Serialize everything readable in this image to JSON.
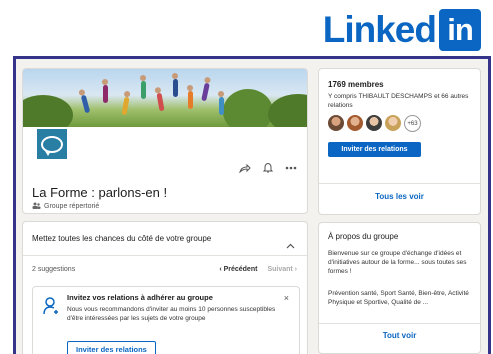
{
  "logo": {
    "text": "Linked",
    "box_text": "in"
  },
  "group": {
    "title": "La Forme : parlons-en !",
    "subtitle": "Groupe répertorié"
  },
  "tips": {
    "title": "Mettez toutes les chances du côté de votre groupe",
    "suggestions_count": "2 suggestions",
    "prev_label": "‹ Précédent",
    "next_label": "Suivant ›",
    "invite_card": {
      "title": "Invitez vos relations à adhérer au groupe",
      "description": "Nous vous recommandons d'inviter au moins 10 personnes susceptibles d'être intéressées par les sujets de votre groupe",
      "button_label": "Inviter des relations",
      "close_label": "×"
    }
  },
  "members": {
    "count_label": "1769 membres",
    "description": "Y compris THIBAULT DESCHAMPS et 66 autres relations",
    "more_avatars_label": "+63",
    "invite_button_label": "Inviter des relations",
    "see_all_label": "Tous les voir"
  },
  "about": {
    "title": "À propos du groupe",
    "paragraph1": "Bienvenue sur ce groupe d'échange d'idées et d'initiatives autour de la forme... sous toutes ses formes !",
    "paragraph2": "Prévention santé, Sport Santé, Bien-être, Activité Physique et Sportive, Qualité de ...",
    "see_all_label": "Tout voir"
  },
  "colors": {
    "brand_blue": "#0a66c2",
    "frame_border": "#35348a",
    "group_logo": "#297ea4",
    "page_bg": "#f3f2ef"
  },
  "icons": [
    "share-icon",
    "bell-icon",
    "more-icon",
    "group-icon",
    "chevron-up-icon",
    "invite-person-icon",
    "close-icon"
  ]
}
